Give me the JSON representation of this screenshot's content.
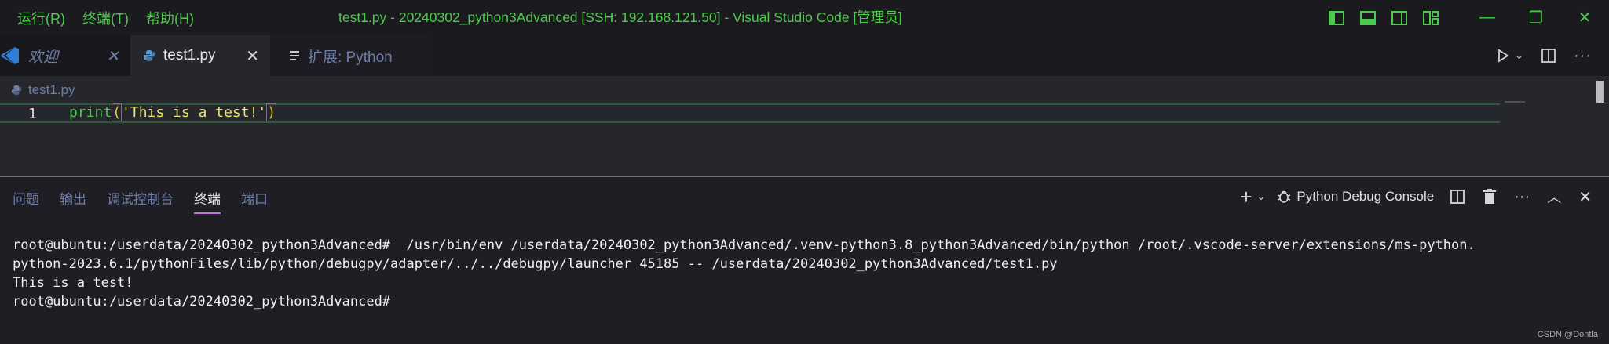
{
  "menu": {
    "items": [
      "运行(R)",
      "终端(T)",
      "帮助(H)"
    ]
  },
  "window": {
    "title": "test1.py - 20240302_python3Advanced [SSH: 192.168.121.50] - Visual Studio Code [管理员]"
  },
  "tabs": [
    {
      "label": "欢迎",
      "icon": "vscode-logo-icon"
    },
    {
      "label": "test1.py",
      "icon": "python-icon"
    },
    {
      "label": "扩展: Python",
      "icon": "extension-list-icon"
    }
  ],
  "editor": {
    "breadcrumb": "test1.py",
    "line_number": "1",
    "code_fn": "print",
    "code_open": "(",
    "code_str": "'This is a test!'",
    "code_close": ")"
  },
  "panel": {
    "tabs": [
      "问题",
      "输出",
      "调试控制台",
      "终端",
      "端口"
    ],
    "active_tab": "终端",
    "console_label": "Python Debug Console",
    "terminal_lines": [
      "root@ubuntu:/userdata/20240302_python3Advanced#  /usr/bin/env /userdata/20240302_python3Advanced/.venv-python3.8_python3Advanced/bin/python /root/.vscode-server/extensions/ms-python.",
      "python-2023.6.1/pythonFiles/lib/python/debugpy/adapter/../../debugpy/launcher 45185 -- /userdata/20240302_python3Advanced/test1.py",
      "This is a test!",
      "root@ubuntu:/userdata/20240302_python3Advanced# "
    ]
  },
  "watermark": "CSDN @Dontla",
  "colors": {
    "accent_green": "#4ec94e",
    "panel_border": "#8a5ca8",
    "active_tab_underline": "#c678dd"
  }
}
